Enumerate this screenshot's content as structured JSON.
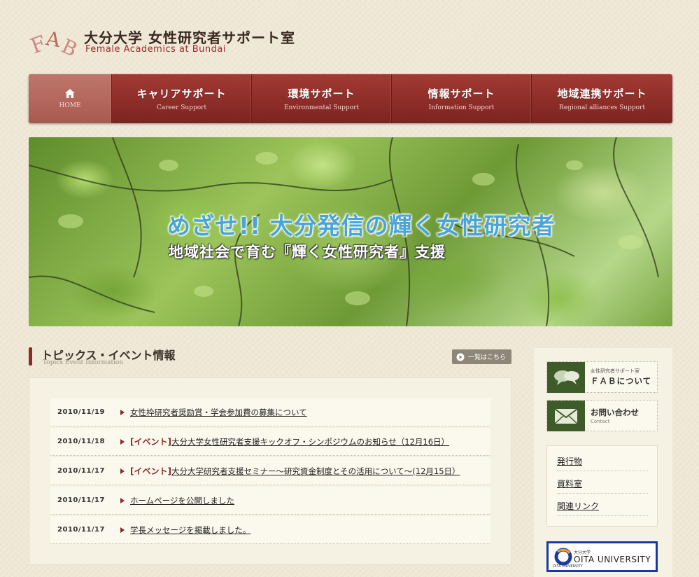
{
  "header": {
    "logo_mark": "FAB",
    "title_ja": "大分大学 女性研究者サポート室",
    "title_en": "Female Academics at Bundai"
  },
  "nav": {
    "items": [
      {
        "ja": "",
        "en": "HOME",
        "icon": "home-icon"
      },
      {
        "ja": "キャリアサポート",
        "en": "Career Support"
      },
      {
        "ja": "環境サポート",
        "en": "Environmental Support"
      },
      {
        "ja": "情報サポート",
        "en": "Information Support"
      },
      {
        "ja": "地域連携サポート",
        "en": "Regional alliances Support"
      }
    ]
  },
  "hero": {
    "title": "めざせ!! 大分発信の輝く女性研究者",
    "subtitle": "地域社会で育む『輝く女性研究者』支援"
  },
  "topics": {
    "title": "トピックス・イベント情報",
    "subtitle": "Topics Event Information",
    "more_label": "一覧はこちら",
    "items": [
      {
        "date": "2010/11/19",
        "tag": "",
        "text": "女性枠研究者奨励賞・学会参加費の募集について"
      },
      {
        "date": "2010/11/18",
        "tag": "[イベント]",
        "text": "大分大学女性研究者支援キックオフ・シンポジウムのお知らせ（12月16日）"
      },
      {
        "date": "2010/11/17",
        "tag": "[イベント]",
        "text": "大分大学研究者支援セミナー～研究資金制度とその活用について～(12月15日）"
      },
      {
        "date": "2010/11/17",
        "tag": "",
        "text": "ホームページを公開しました"
      },
      {
        "date": "2010/11/17",
        "tag": "",
        "text": "学長メッセージを掲載しました。"
      }
    ]
  },
  "sidebar": {
    "about": {
      "small": "女性研究者サポート室",
      "label": "ＦＡＢについて",
      "icon": "speech-bubbles-icon"
    },
    "contact": {
      "label": "お問い合わせ",
      "en": "Contact",
      "icon": "envelope-icon"
    },
    "links": [
      "発行物",
      "資料室",
      "関連リンク"
    ],
    "university": {
      "small": "大分大学",
      "name": "OITA UNIVERSITY",
      "tiny": "OITA UNIVERSITY"
    }
  },
  "colors": {
    "nav_red": "#8c2a26",
    "accent_blue": "#4aa4d6",
    "sidebar_green": "#3e5b2a"
  }
}
